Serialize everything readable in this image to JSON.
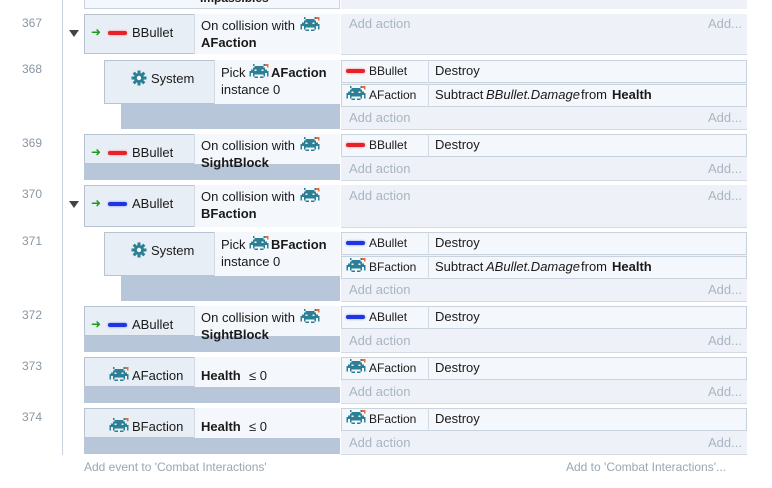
{
  "group_name": "Combat Interactions",
  "colors": {
    "accent": "#2a8fa3",
    "red_bullet": "#e8202a",
    "blue_bullet": "#1f35e0",
    "green_arrow": "#1e9a1e"
  },
  "top_partial": {
    "text": "Impassibles"
  },
  "events": [
    {
      "number": "367",
      "object": "BBullet",
      "condition": {
        "prefix": "On collision with",
        "target": "AFaction"
      },
      "add_action": "Add action",
      "add_action_alt": "Add..."
    },
    {
      "number": "368",
      "object": "System",
      "condition": {
        "prefix": "Pick",
        "target": "AFaction",
        "suffix": "instance 0"
      },
      "actions": [
        {
          "object": "BBullet",
          "action": "Destroy"
        },
        {
          "object": "AFaction",
          "action_pre": "Subtract",
          "expression": "BBullet.Damage",
          "action_mid": "from",
          "variable": "Health"
        }
      ],
      "add_action": "Add action",
      "add_action_alt": "Add..."
    },
    {
      "number": "369",
      "object": "BBullet",
      "condition": {
        "prefix": "On collision with",
        "target": "SightBlock"
      },
      "actions": [
        {
          "object": "BBullet",
          "action": "Destroy"
        }
      ],
      "add_action": "Add action",
      "add_action_alt": "Add..."
    },
    {
      "number": "370",
      "object": "ABullet",
      "condition": {
        "prefix": "On collision with",
        "target": "BFaction"
      },
      "add_action": "Add action",
      "add_action_alt": "Add..."
    },
    {
      "number": "371",
      "object": "System",
      "condition": {
        "prefix": "Pick",
        "target": "BFaction",
        "suffix": "instance 0"
      },
      "actions": [
        {
          "object": "ABullet",
          "action": "Destroy"
        },
        {
          "object": "BFaction",
          "action_pre": "Subtract",
          "expression": "ABullet.Damage",
          "action_mid": "from",
          "variable": "Health"
        }
      ],
      "add_action": "Add action",
      "add_action_alt": "Add..."
    },
    {
      "number": "372",
      "object": "ABullet",
      "condition": {
        "prefix": "On collision with",
        "target": "SightBlock"
      },
      "actions": [
        {
          "object": "ABullet",
          "action": "Destroy"
        }
      ],
      "add_action": "Add action",
      "add_action_alt": "Add..."
    },
    {
      "number": "373",
      "object": "AFaction",
      "condition": {
        "target": "Health",
        "suffix": "≤ 0"
      },
      "actions": [
        {
          "object": "AFaction",
          "action": "Destroy"
        }
      ],
      "add_action": "Add action",
      "add_action_alt": "Add..."
    },
    {
      "number": "374",
      "object": "BFaction",
      "condition": {
        "target": "Health",
        "suffix": "≤ 0"
      },
      "actions": [
        {
          "object": "BFaction",
          "action": "Destroy"
        }
      ],
      "add_action": "Add action",
      "add_action_alt": "Add..."
    }
  ],
  "footer": {
    "add_event": "Add event to 'Combat Interactions'",
    "add_to": "Add to 'Combat Interactions'..."
  }
}
